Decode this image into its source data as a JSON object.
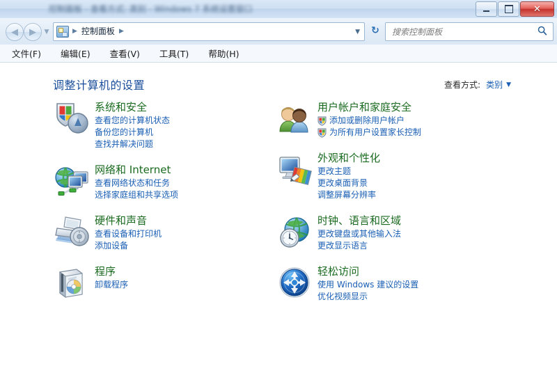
{
  "window": {
    "title_blurred_text": "控制面板 - 查看方式: 类别 - Windows 7 系统设置窗口",
    "buttons": {
      "minimize": "最小化",
      "maximize": "最大化",
      "close": "✕"
    }
  },
  "nav": {
    "back": "◀",
    "forward": "▶",
    "history_caret": "▼",
    "breadcrumb_icon": "control-panel-icon",
    "breadcrumb": [
      "控制面板"
    ],
    "breadcrumb_sep": "▶",
    "address_caret": "▼",
    "refresh": "↻"
  },
  "search": {
    "placeholder": "搜索控制面板",
    "value": "",
    "icon": "search-icon"
  },
  "menu": {
    "items": [
      "文件(F)",
      "编辑(E)",
      "查看(V)",
      "工具(T)",
      "帮助(H)"
    ]
  },
  "main": {
    "page_title": "调整计算机的设置",
    "view_by_label": "查看方式:",
    "view_by_value": "类别",
    "view_by_caret": "▼"
  },
  "categories": {
    "left": [
      {
        "icon": "security-shield-icon",
        "title": "系统和安全",
        "links": [
          "查看您的计算机状态",
          "备份您的计算机",
          "查找并解决问题"
        ]
      },
      {
        "icon": "network-globe-icon",
        "title": "网络和 Internet",
        "links": [
          "查看网络状态和任务",
          "选择家庭组和共享选项"
        ]
      },
      {
        "icon": "printer-sound-icon",
        "title": "硬件和声音",
        "links": [
          "查看设备和打印机",
          "添加设备"
        ]
      },
      {
        "icon": "programs-box-icon",
        "title": "程序",
        "links": [
          "卸载程序"
        ]
      }
    ],
    "right": [
      {
        "icon": "user-accounts-icon",
        "title": "用户帐户和家庭安全",
        "links": [
          "添加或删除用户帐户",
          "为所有用户设置家长控制"
        ],
        "link_badges": [
          "uac-shield-icon",
          "uac-shield-icon"
        ]
      },
      {
        "icon": "appearance-monitor-icon",
        "title": "外观和个性化",
        "links": [
          "更改主题",
          "更改桌面背景",
          "调整屏幕分辨率"
        ]
      },
      {
        "icon": "clock-globe-icon",
        "title": "时钟、语言和区域",
        "links": [
          "更改键盘或其他输入法",
          "更改显示语言"
        ]
      },
      {
        "icon": "ease-of-access-icon",
        "title": "轻松访问",
        "links": [
          "使用 Windows 建议的设置",
          "优化视频显示"
        ]
      }
    ]
  },
  "colors": {
    "category_title": "#1a6b1f",
    "link": "#1a5fb4",
    "page_title": "#1b4e9b",
    "close_button": "#c3332c",
    "aero_glass": "#cfe0f3"
  }
}
